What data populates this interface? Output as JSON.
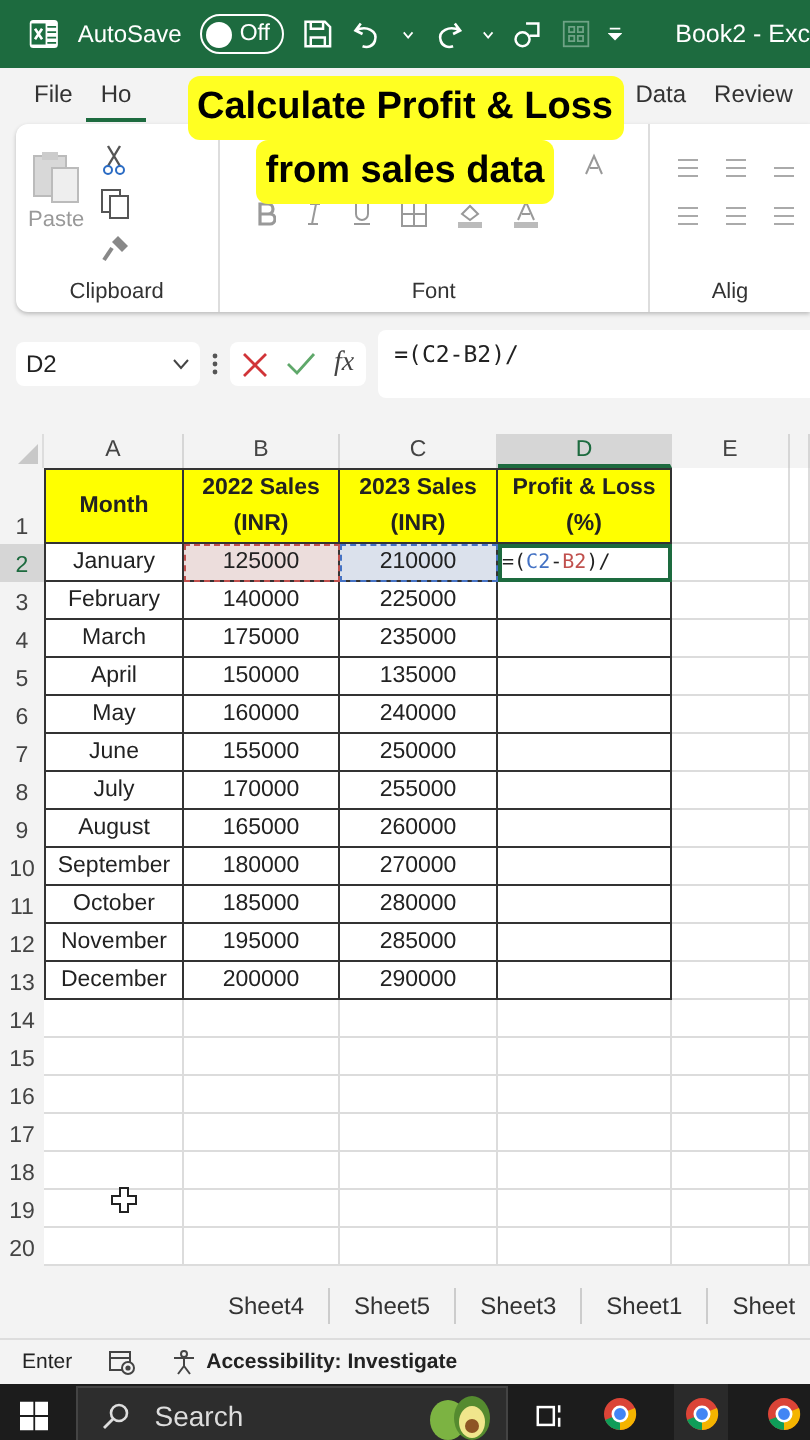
{
  "title_bar": {
    "autosave_label": "AutoSave",
    "autosave_toggle": {
      "label": "Off",
      "on": false
    },
    "document_title": "Book2 - Exc"
  },
  "ribbon_tabs": [
    {
      "label": "File",
      "selected": false
    },
    {
      "label": "Ho",
      "selected": true
    },
    {
      "label": "Data",
      "selected": false
    },
    {
      "label": "Review",
      "selected": false
    }
  ],
  "ribbon": {
    "paste_label": "Paste",
    "groups": [
      "Clipboard",
      "Font",
      "Alig"
    ]
  },
  "caption": {
    "lines": [
      "Calculate Profit & Loss",
      "from sales data"
    ]
  },
  "formula_bar": {
    "name_box": "D2",
    "formula": "=(C2-B2)/",
    "fx_label": "fx"
  },
  "sheet": {
    "columns": [
      {
        "label": "A",
        "selected": false
      },
      {
        "label": "B",
        "selected": false
      },
      {
        "label": "C",
        "selected": false
      },
      {
        "label": "D",
        "selected": true
      },
      {
        "label": "E",
        "selected": false
      }
    ],
    "rows": [
      {
        "number": "1",
        "selected": false,
        "kind": "header",
        "cells": [
          {
            "text": "Month"
          },
          {
            "text": "2022 Sales (INR)"
          },
          {
            "text": "2023 Sales (INR)"
          },
          {
            "text": "Profit & Loss (%)"
          }
        ]
      },
      {
        "number": "2",
        "selected": true,
        "kind": "data",
        "cells": [
          {
            "text": "January"
          },
          {
            "text": "125000",
            "color": "#c0504d"
          },
          {
            "text": "210000",
            "color": "#4472c4"
          },
          {
            "kind": "formula",
            "parts": [
              {
                "text": "=("
              },
              {
                "text": "C2",
                "color": "#4472c4"
              },
              {
                "text": "-"
              },
              {
                "text": "B2",
                "color": "#c0504d"
              },
              {
                "text": ")/"
              }
            ]
          }
        ]
      },
      {
        "number": "3",
        "selected": false,
        "kind": "data",
        "cells": [
          {
            "text": "February"
          },
          {
            "text": "140000"
          },
          {
            "text": "225000"
          },
          {
            "text": ""
          }
        ]
      },
      {
        "number": "4",
        "selected": false,
        "kind": "data",
        "cells": [
          {
            "text": "March"
          },
          {
            "text": "175000"
          },
          {
            "text": "235000"
          },
          {
            "text": ""
          }
        ]
      },
      {
        "number": "5",
        "selected": false,
        "kind": "data",
        "cells": [
          {
            "text": "April"
          },
          {
            "text": "150000"
          },
          {
            "text": "135000"
          },
          {
            "text": ""
          }
        ]
      },
      {
        "number": "6",
        "selected": false,
        "kind": "data",
        "cells": [
          {
            "text": "May"
          },
          {
            "text": "160000"
          },
          {
            "text": "240000"
          },
          {
            "text": ""
          }
        ]
      },
      {
        "number": "7",
        "selected": false,
        "kind": "data",
        "cells": [
          {
            "text": "June"
          },
          {
            "text": "155000"
          },
          {
            "text": "250000"
          },
          {
            "text": ""
          }
        ]
      },
      {
        "number": "8",
        "selected": false,
        "kind": "data",
        "cells": [
          {
            "text": "July"
          },
          {
            "text": "170000"
          },
          {
            "text": "255000"
          },
          {
            "text": ""
          }
        ]
      },
      {
        "number": "9",
        "selected": false,
        "kind": "data",
        "cells": [
          {
            "text": "August"
          },
          {
            "text": "165000"
          },
          {
            "text": "260000"
          },
          {
            "text": ""
          }
        ]
      },
      {
        "number": "10",
        "selected": false,
        "kind": "data",
        "cells": [
          {
            "text": "September"
          },
          {
            "text": "180000"
          },
          {
            "text": "270000"
          },
          {
            "text": ""
          }
        ]
      },
      {
        "number": "11",
        "selected": false,
        "kind": "data",
        "cells": [
          {
            "text": "October"
          },
          {
            "text": "185000"
          },
          {
            "text": "280000"
          },
          {
            "text": ""
          }
        ]
      },
      {
        "number": "12",
        "selected": false,
        "kind": "data",
        "cells": [
          {
            "text": "November"
          },
          {
            "text": "195000"
          },
          {
            "text": "285000"
          },
          {
            "text": ""
          }
        ]
      },
      {
        "number": "13",
        "selected": false,
        "kind": "data",
        "cells": [
          {
            "text": "December"
          },
          {
            "text": "200000"
          },
          {
            "text": "290000"
          },
          {
            "text": ""
          }
        ]
      },
      {
        "number": "14",
        "selected": false,
        "kind": "empty"
      },
      {
        "number": "15",
        "selected": false,
        "kind": "empty"
      },
      {
        "number": "16",
        "selected": false,
        "kind": "empty"
      },
      {
        "number": "17",
        "selected": false,
        "kind": "empty"
      },
      {
        "number": "18",
        "selected": false,
        "kind": "empty"
      },
      {
        "number": "19",
        "selected": false,
        "kind": "empty"
      },
      {
        "number": "20",
        "selected": false,
        "kind": "empty"
      }
    ]
  },
  "sheet_tabs": [
    {
      "label": "Sheet4",
      "selected": false
    },
    {
      "label": "Sheet5",
      "selected": false
    },
    {
      "label": "Sheet3",
      "selected": false
    },
    {
      "label": "Sheet1",
      "selected": false
    },
    {
      "label": "Sheet",
      "selected": false
    }
  ],
  "status_bar": {
    "mode": "Enter",
    "accessibility": "Accessibility: Investigate"
  },
  "taskbar": {
    "search_placeholder": "Search",
    "apps": [
      {
        "selected": false
      },
      {
        "selected": true
      },
      {
        "selected": false
      }
    ]
  }
}
